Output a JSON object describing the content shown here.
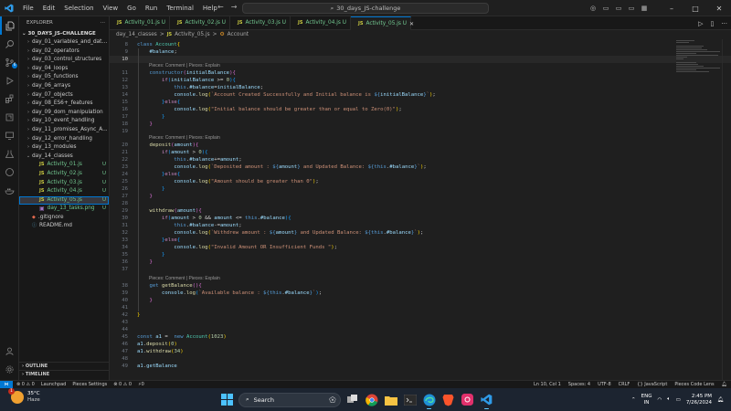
{
  "titlebar": {
    "menu": [
      "File",
      "Edit",
      "Selection",
      "View",
      "Go",
      "Run",
      "Terminal",
      "Help"
    ],
    "search": "30_days_JS-challenge",
    "nav_back": "←",
    "nav_forward": "→"
  },
  "sidebar": {
    "header": "EXPLORER",
    "root": "30_DAYS_JS-CHALLENGE",
    "items": [
      {
        "label": "day_01_variables_and_data...",
        "type": "folder"
      },
      {
        "label": "day_02_operators",
        "type": "folder"
      },
      {
        "label": "day_03_control_structures",
        "type": "folder"
      },
      {
        "label": "day_04_loops",
        "type": "folder"
      },
      {
        "label": "day_05_functions",
        "type": "folder"
      },
      {
        "label": "day_06_arrays",
        "type": "folder"
      },
      {
        "label": "day_07_objects",
        "type": "folder"
      },
      {
        "label": "day_08_ES6+_features",
        "type": "folder"
      },
      {
        "label": "day_09_dom_manipulation",
        "type": "folder"
      },
      {
        "label": "day_10_event_handling",
        "type": "folder"
      },
      {
        "label": "day_11_promises_Async_A...",
        "type": "folder"
      },
      {
        "label": "day_12_error_handling",
        "type": "folder"
      },
      {
        "label": "day_13_modules",
        "type": "folder"
      },
      {
        "label": "day_14_classes",
        "type": "folder-open"
      },
      {
        "label": "Activity_01.js",
        "type": "file",
        "status": "U"
      },
      {
        "label": "Activity_02.js",
        "type": "file",
        "status": "U"
      },
      {
        "label": "Activity_03.js",
        "type": "file",
        "status": "U"
      },
      {
        "label": "Activity_04.js",
        "type": "file",
        "status": "U"
      },
      {
        "label": "Activity_05.js",
        "type": "file",
        "status": "U"
      },
      {
        "label": "day_13_tasks.png",
        "type": "image",
        "status": "U"
      },
      {
        "label": ".gitignore",
        "type": "plain"
      },
      {
        "label": "README.md",
        "type": "plain"
      }
    ],
    "outline": "OUTLINE",
    "timeline": "TIMELINE"
  },
  "tabs": [
    {
      "label": "Activity_01.js U",
      "active": false
    },
    {
      "label": "Activity_02.js U",
      "active": false
    },
    {
      "label": "Activity_03.js U",
      "active": false
    },
    {
      "label": "Activity_04.js U",
      "active": false
    },
    {
      "label": "Activity_05.js U",
      "active": true
    }
  ],
  "breadcrumb": [
    "day_14_classes",
    ">",
    "Activity_05.js",
    ">",
    "Account"
  ],
  "code_lens": "Pieces: Comment | Pieces: Explain",
  "statusbar": {
    "left": [
      "⊗ 0 ⚠ 0",
      "Launchpad",
      "Pieces Settings",
      "⊗ 0 ⚠ 0",
      "⚡0"
    ],
    "right": [
      "Ln 10, Col 1",
      "Spaces: 4",
      "UTF-8",
      "CRLF",
      "{} JavaScript",
      "Pieces Code Lens"
    ]
  },
  "taskbar": {
    "weather_temp": "35°C",
    "weather_cond": "Haze",
    "weather_badge": "1",
    "search": "Search",
    "lang_1": "ENG",
    "lang_2": "IN",
    "time": "2:45 PM",
    "date": "7/26/2024"
  },
  "colors": {
    "accent": "#0078d4",
    "untracked": "#73c991",
    "js_icon": "#cbcb41"
  }
}
